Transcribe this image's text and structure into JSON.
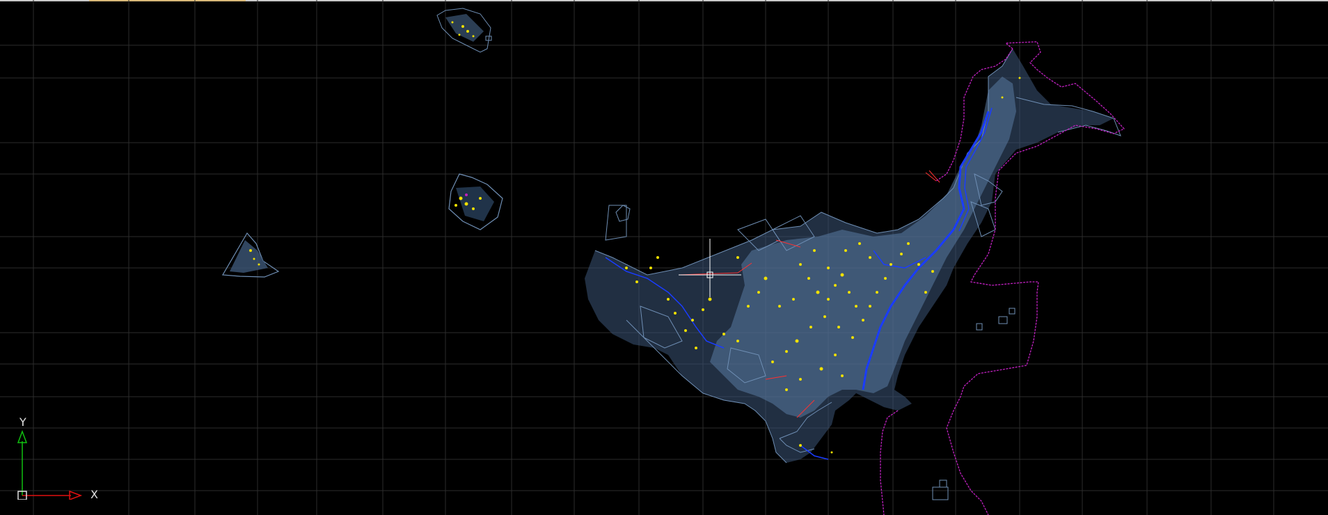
{
  "viewport": {
    "background": "#000000",
    "grid_color": "#2e2e2e",
    "geometry_color": "#6f8fb5",
    "building_color": "#f0e000",
    "boundary_color": "#c020c0",
    "river_color": "#1a3cff",
    "accent_red": "#ff3030"
  },
  "ucs": {
    "icon": "ucs-icon",
    "x_label": "X",
    "y_label": "Y",
    "x_axis_color": "#e01010",
    "y_axis_color": "#10c010"
  },
  "cursor": {
    "icon": "crosshair-cursor-icon",
    "color": "#ffffff"
  }
}
